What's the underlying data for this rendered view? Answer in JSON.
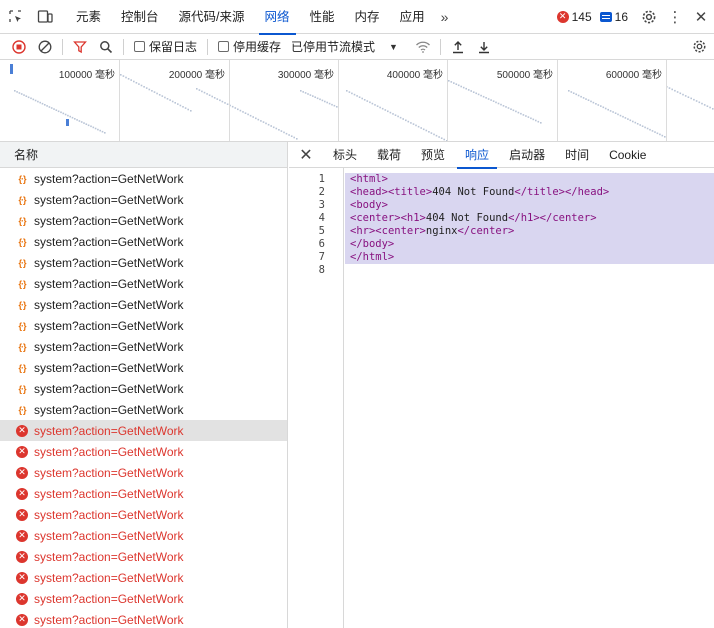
{
  "topbar": {
    "tabs": [
      {
        "label": "元素",
        "active": false
      },
      {
        "label": "控制台",
        "active": false
      },
      {
        "label": "源代码/来源",
        "active": false
      },
      {
        "label": "网络",
        "active": true
      },
      {
        "label": "性能",
        "active": false
      },
      {
        "label": "内存",
        "active": false
      },
      {
        "label": "应用",
        "active": false
      }
    ],
    "more_label": "»",
    "error_count": "145",
    "message_count": "16"
  },
  "toolbar": {
    "preserve_log_label": "保留日志",
    "disable_cache_label": "停用缓存",
    "throttle_label": "已停用节流模式"
  },
  "overview": {
    "ticks": [
      "100000 毫秒",
      "200000 毫秒",
      "300000 毫秒",
      "400000 毫秒",
      "500000 毫秒",
      "600000 毫秒"
    ]
  },
  "list": {
    "header": "名称",
    "rows": [
      {
        "name": "system?action=GetNetWork",
        "status": "ok"
      },
      {
        "name": "system?action=GetNetWork",
        "status": "ok"
      },
      {
        "name": "system?action=GetNetWork",
        "status": "ok"
      },
      {
        "name": "system?action=GetNetWork",
        "status": "ok"
      },
      {
        "name": "system?action=GetNetWork",
        "status": "ok"
      },
      {
        "name": "system?action=GetNetWork",
        "status": "ok"
      },
      {
        "name": "system?action=GetNetWork",
        "status": "ok"
      },
      {
        "name": "system?action=GetNetWork",
        "status": "ok"
      },
      {
        "name": "system?action=GetNetWork",
        "status": "ok"
      },
      {
        "name": "system?action=GetNetWork",
        "status": "ok"
      },
      {
        "name": "system?action=GetNetWork",
        "status": "ok"
      },
      {
        "name": "system?action=GetNetWork",
        "status": "ok"
      },
      {
        "name": "system?action=GetNetWork",
        "status": "error",
        "selected": true
      },
      {
        "name": "system?action=GetNetWork",
        "status": "error"
      },
      {
        "name": "system?action=GetNetWork",
        "status": "error"
      },
      {
        "name": "system?action=GetNetWork",
        "status": "error"
      },
      {
        "name": "system?action=GetNetWork",
        "status": "error"
      },
      {
        "name": "system?action=GetNetWork",
        "status": "error"
      },
      {
        "name": "system?action=GetNetWork",
        "status": "error"
      },
      {
        "name": "system?action=GetNetWork",
        "status": "error"
      },
      {
        "name": "system?action=GetNetWork",
        "status": "error"
      },
      {
        "name": "system?action=GetNetWork",
        "status": "error"
      }
    ]
  },
  "detail": {
    "tabs": [
      {
        "label": "标头",
        "active": false
      },
      {
        "label": "载荷",
        "active": false
      },
      {
        "label": "预览",
        "active": false
      },
      {
        "label": "响应",
        "active": true
      },
      {
        "label": "启动器",
        "active": false
      },
      {
        "label": "时间",
        "active": false
      },
      {
        "label": "Cookie",
        "active": false
      }
    ],
    "response_lines": [
      "<html>",
      "<head><title>404 Not Found</title></head>",
      "<body>",
      "<center><h1>404 Not Found</h1></center>",
      "<hr><center>nginx</center>",
      "</body>",
      "</html>",
      ""
    ]
  },
  "colors": {
    "accent": "#0b57d0",
    "error": "#dc362e",
    "tag": "#881280",
    "highlight": "#d9d6f0"
  }
}
